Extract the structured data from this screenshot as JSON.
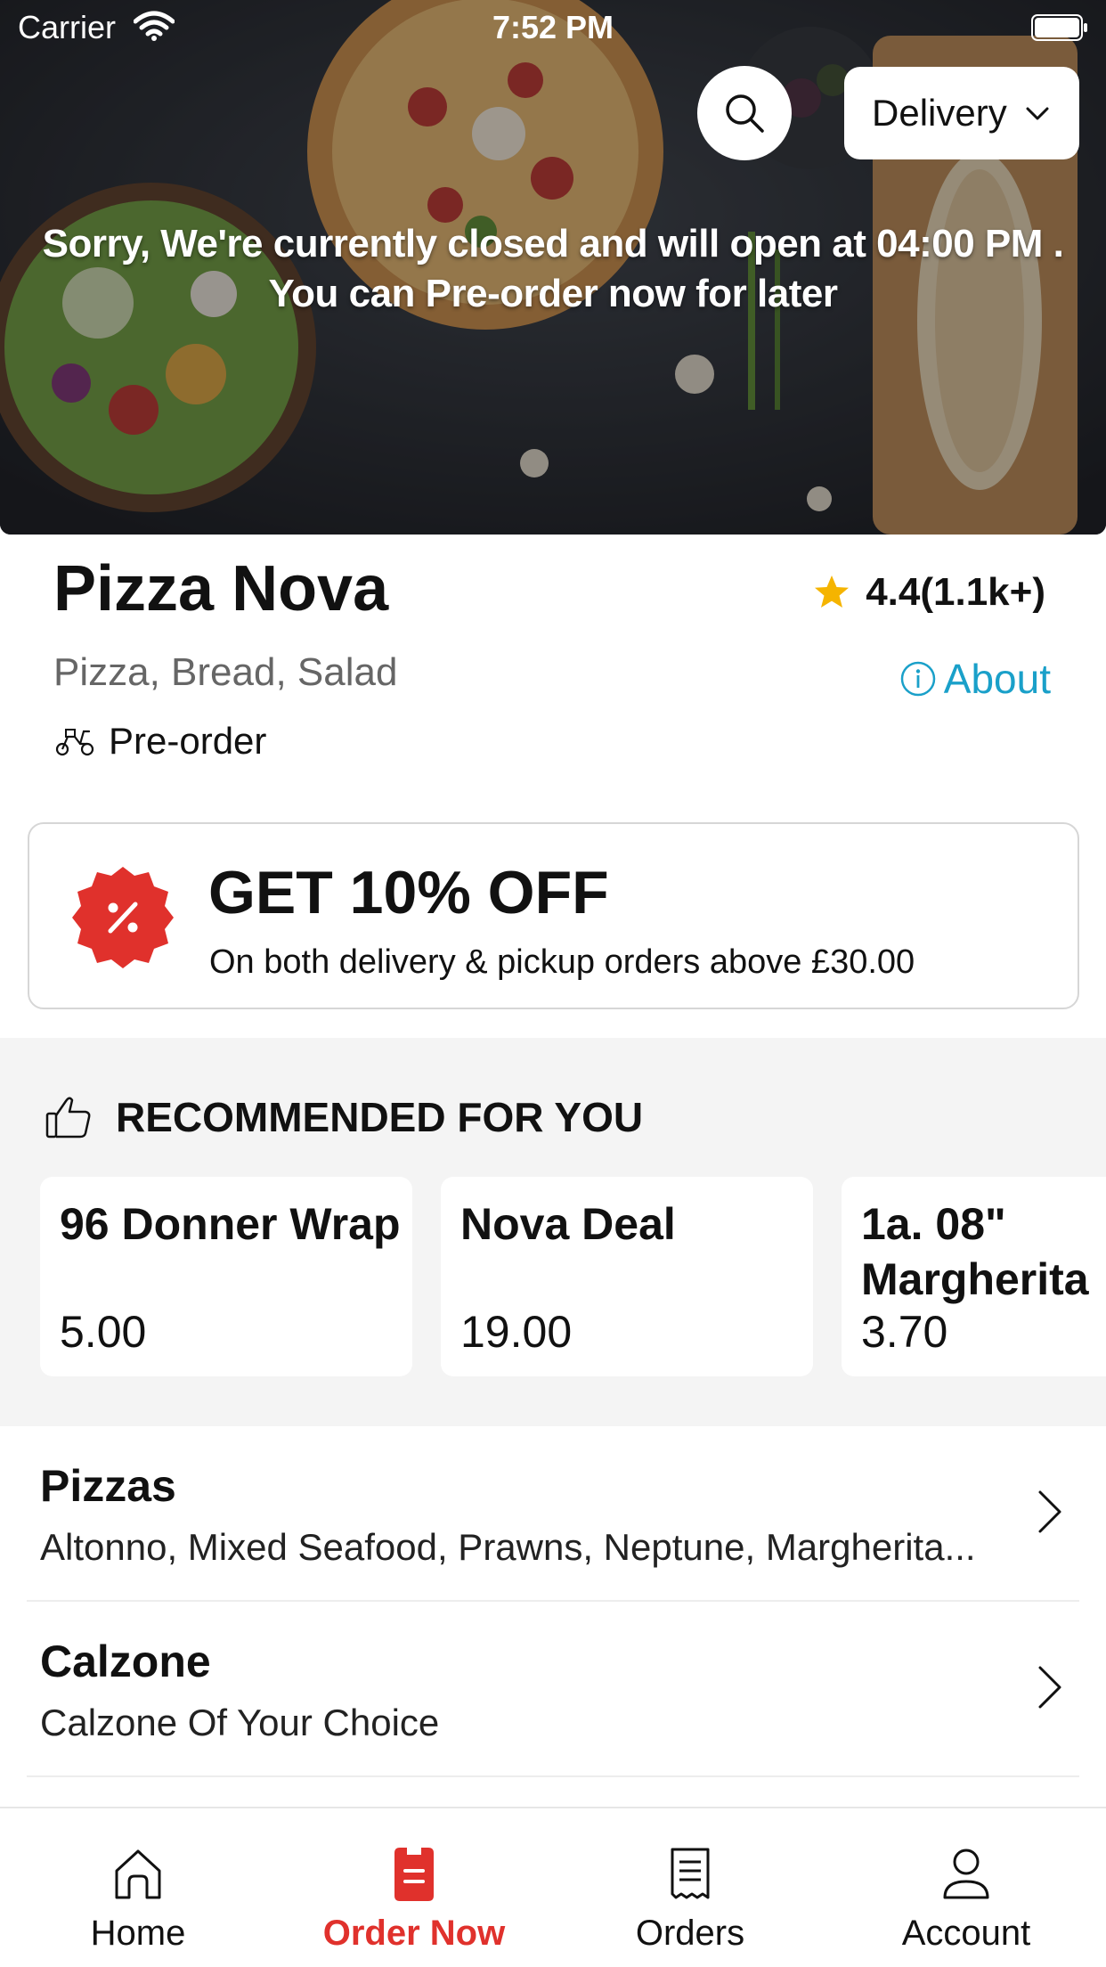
{
  "status": {
    "carrier": "Carrier",
    "time": "7:52 PM"
  },
  "header": {
    "delivery_label": "Delivery"
  },
  "hero": {
    "closed_line1": "Sorry, We're currently closed and will open at 04:00 PM .",
    "closed_line2": "You can Pre-order now for later"
  },
  "restaurant": {
    "name": "Pizza Nova",
    "rating": "4.4(1.1k+)",
    "cuisine": "Pizza, Bread, Salad",
    "about_label": "About",
    "order_mode": "Pre-order"
  },
  "promo": {
    "title": "GET 10% OFF",
    "subtitle": "On both delivery & pickup orders above £30.00"
  },
  "recommended": {
    "title": "RECOMMENDED FOR YOU",
    "items": [
      {
        "name": "96 Donner Wrap",
        "price": "5.00"
      },
      {
        "name": "Nova Deal",
        "price": "19.00"
      },
      {
        "name": "1a. 08\" Margherita",
        "price": "3.70"
      }
    ]
  },
  "categories": [
    {
      "name": "Pizzas",
      "desc": "Altonno, Mixed Seafood, Prawns, Neptune, Margherita..."
    },
    {
      "name": "Calzone",
      "desc": "Calzone Of Your Choice"
    }
  ],
  "tabs": [
    {
      "label": "Home",
      "icon": "home-icon"
    },
    {
      "label": "Order Now",
      "icon": "order-now-icon",
      "active": true
    },
    {
      "label": "Orders",
      "icon": "receipt-icon"
    },
    {
      "label": "Account",
      "icon": "user-icon"
    }
  ],
  "colors": {
    "accent": "#e0312c",
    "link": "#1aa0c9",
    "star": "#f5b400",
    "section_bg": "#f4f4f4"
  }
}
